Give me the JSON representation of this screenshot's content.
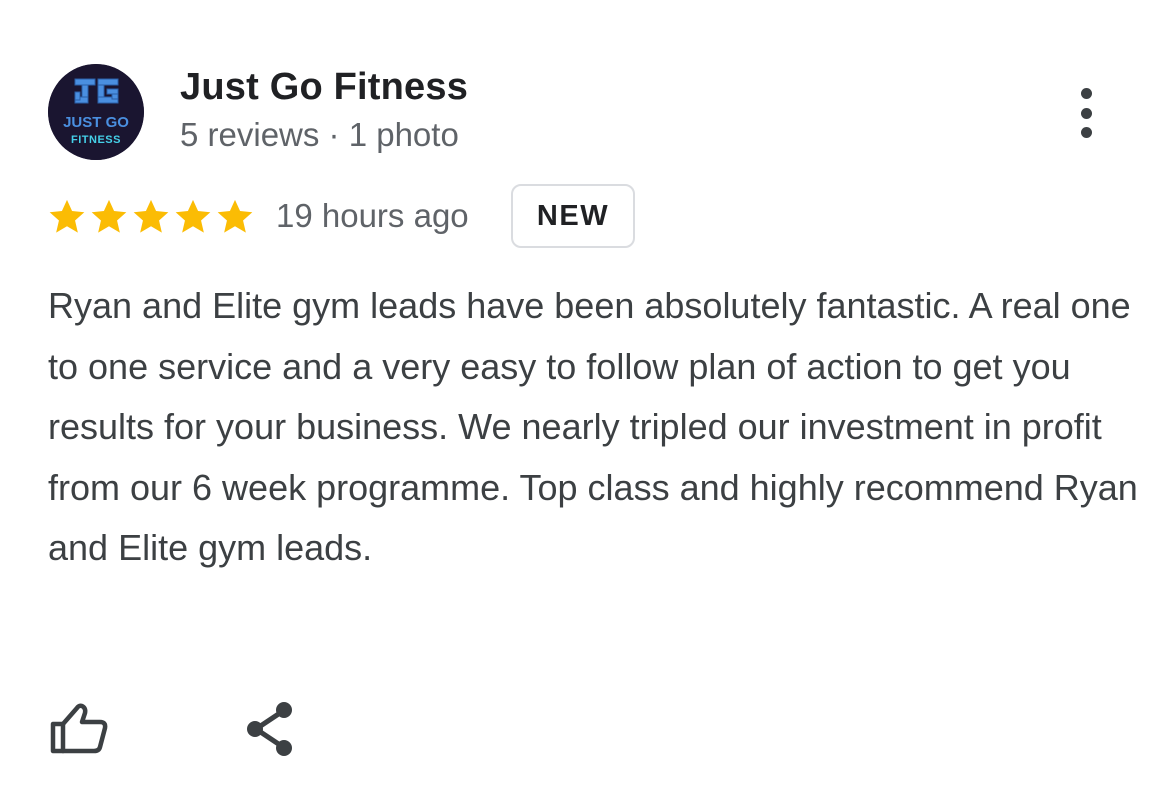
{
  "reviewer": {
    "name": "Just Go Fitness",
    "meta": "5 reviews · 1 photo",
    "avatar_logo": {
      "monogram": "JG",
      "line1": "JUST GO",
      "line2": "FITNESS"
    }
  },
  "rating": {
    "stars": 5,
    "max_stars": 5
  },
  "timestamp": "19 hours ago",
  "badge": "NEW",
  "review_text": "Ryan and Elite gym leads have been absolutely fantastic. A real one to one service and a very easy to follow plan of action to get you results for your business. We nearly tripled our investment in profit from our 6 week programme. Top class and highly recommend Ryan and Elite gym leads.",
  "icons": {
    "more": "more-vert-icon",
    "star": "star-icon",
    "like": "thumbs-up-icon",
    "share": "share-icon"
  },
  "colors": {
    "star": "#FBBC04",
    "name_text": "#202124",
    "secondary_text": "#5F6368",
    "body_text": "#3C4043",
    "badge_border": "#DADCE0",
    "avatar_bg": "#1A1530",
    "logo_blue": "#4A8FE0",
    "logo_cyan": "#45D0E8"
  }
}
